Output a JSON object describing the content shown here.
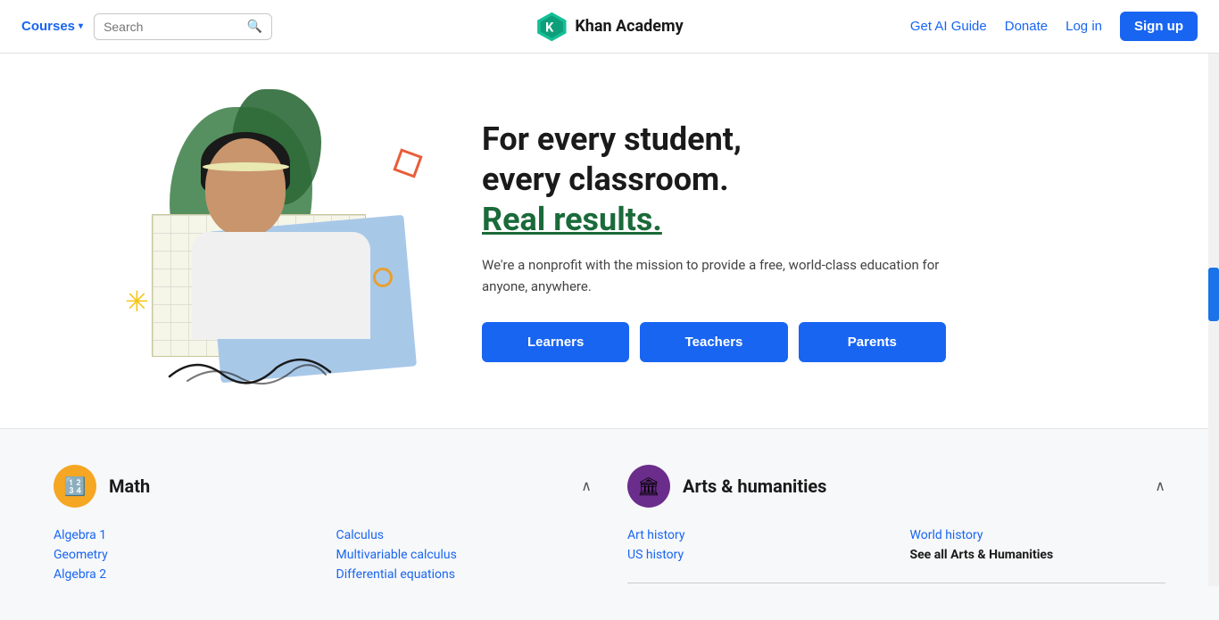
{
  "navbar": {
    "courses_label": "Courses",
    "search_placeholder": "Search",
    "logo_text": "Khan Academy",
    "get_ai_guide_label": "Get AI Guide",
    "donate_label": "Donate",
    "login_label": "Log in",
    "signup_label": "Sign up"
  },
  "hero": {
    "headline_line1": "For every student,",
    "headline_line2": "every classroom.",
    "headline_line3": "Real results.",
    "subtext": "We're a nonprofit with the mission to provide a free, world-class education for anyone, anywhere.",
    "btn_learners": "Learners",
    "btn_teachers": "Teachers",
    "btn_parents": "Parents"
  },
  "math": {
    "title": "Math",
    "icon": "🔢",
    "courses_col1": [
      "Algebra 1",
      "Geometry",
      "Algebra 2"
    ],
    "courses_col2": [
      "Calculus",
      "Multivariable calculus",
      "Differential equations"
    ]
  },
  "arts": {
    "title": "Arts & humanities",
    "icon": "🏛",
    "courses_col1": [
      "Art history",
      "US history"
    ],
    "courses_col2": [
      "World history",
      "See all Arts & Humanities"
    ]
  },
  "icons": {
    "search": "🔍",
    "chevron_down": "▾",
    "chevron_up": "∧",
    "star": "✳",
    "square_deco": "□",
    "circle_deco": "○"
  },
  "colors": {
    "brand_blue": "#1865f2",
    "math_yellow": "#f5a623",
    "arts_purple": "#6b2d8b",
    "green_dark": "#1a6a3a"
  }
}
